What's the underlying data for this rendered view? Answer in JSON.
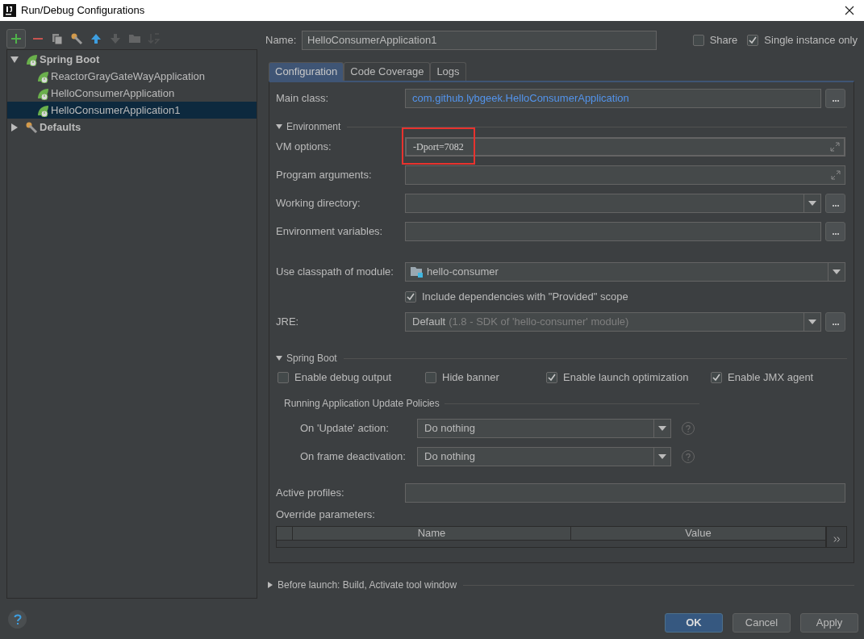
{
  "window": {
    "title": "Run/Debug Configurations"
  },
  "toolbar": [
    {
      "kind": "add",
      "disabled": false
    },
    {
      "kind": "remove",
      "disabled": false
    },
    {
      "kind": "copy",
      "disabled": false
    },
    {
      "kind": "wrench",
      "disabled": false
    },
    {
      "kind": "up",
      "disabled": false
    },
    {
      "kind": "down",
      "disabled": true
    },
    {
      "kind": "folder",
      "disabled": true
    },
    {
      "kind": "sort",
      "disabled": true
    }
  ],
  "tree": [
    {
      "label": "Spring Boot",
      "kind": "spring",
      "expanded": true,
      "selected": false,
      "children": [
        {
          "label": "ReactorGrayGateWayApplication",
          "kind": "spring",
          "selected": false
        },
        {
          "label": "HelloConsumerApplication",
          "kind": "spring",
          "selected": false
        },
        {
          "label": "HelloConsumerApplication1",
          "kind": "spring",
          "selected": true
        }
      ]
    },
    {
      "label": "Defaults",
      "kind": "defaults",
      "expanded": false,
      "selected": false
    }
  ],
  "name": {
    "label": "Name:",
    "value": "HelloConsumerApplication1"
  },
  "options": [
    {
      "label": "Share",
      "checked": false
    },
    {
      "label": "Single instance only",
      "checked": true
    }
  ],
  "tabs": [
    {
      "label": "Configuration",
      "selected": true
    },
    {
      "label": "Code Coverage",
      "selected": false
    },
    {
      "label": "Logs",
      "selected": false
    }
  ],
  "main_class": {
    "label": "Main class:",
    "value": "com.github.lybgeek.HelloConsumerApplication"
  },
  "environment": {
    "title": "Environment",
    "expanded": true,
    "fields": [
      {
        "kind": "expand",
        "label": "VM options:",
        "value": "-Dport=7082",
        "focused": true,
        "highlighted": true
      },
      {
        "kind": "expand",
        "label": "Program arguments:",
        "focused": false,
        "highlighted": false
      },
      {
        "kind": "combo",
        "label": "Working directory:",
        "focused": false,
        "highlighted": false
      },
      {
        "kind": "browse",
        "label": "Environment variables:",
        "focused": false,
        "highlighted": false
      }
    ]
  },
  "classpath": {
    "label": "Use classpath of module:",
    "value": "hello-consumer"
  },
  "include_provided": {
    "label": "Include dependencies with \"Provided\" scope",
    "checked": true
  },
  "jre": {
    "label": "JRE:",
    "value": "Default",
    "hint": "(1.8 - SDK of 'hello-consumer' module)"
  },
  "spring_boot": {
    "title": "Spring Boot",
    "expanded": true,
    "options": [
      {
        "label": "Enable debug output",
        "checked": false
      },
      {
        "label": "Hide banner",
        "checked": false
      },
      {
        "label": "Enable launch optimization",
        "checked": true
      },
      {
        "label": "Enable JMX agent",
        "checked": true
      }
    ],
    "policies": {
      "title": "Running Application Update Policies",
      "items": [
        {
          "label": "On 'Update' action:",
          "value": "Do nothing"
        },
        {
          "label": "On frame deactivation:",
          "value": "Do nothing"
        }
      ]
    }
  },
  "active_profiles": {
    "label": "Active profiles:"
  },
  "override": {
    "label": "Override parameters:",
    "columns": [
      "Name",
      "Value"
    ]
  },
  "before_launch": {
    "title": "Before launch: Build, Activate tool window",
    "expanded": false
  },
  "buttons": [
    {
      "label": "OK",
      "default": true
    },
    {
      "label": "Cancel",
      "default": false
    },
    {
      "label": "Apply",
      "default": false
    }
  ]
}
